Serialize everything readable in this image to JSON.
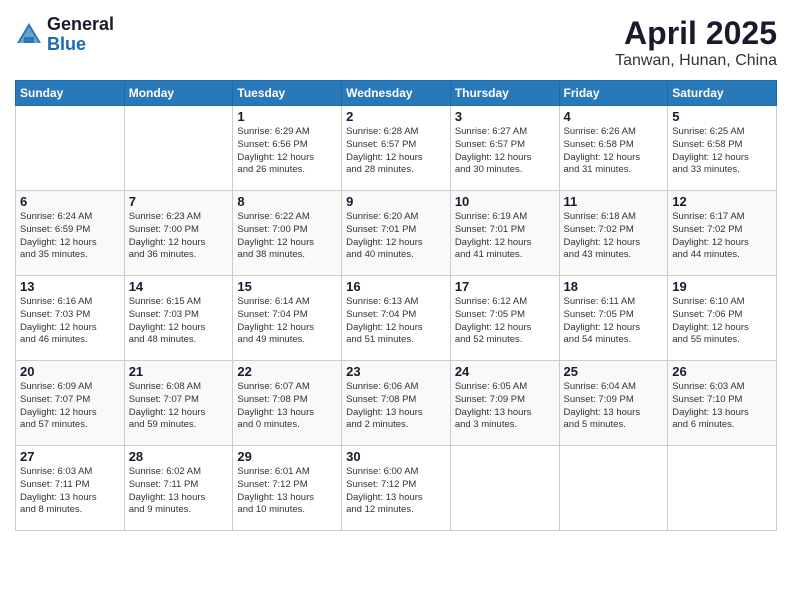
{
  "logo": {
    "general": "General",
    "blue": "Blue"
  },
  "title": "April 2025",
  "subtitle": "Tanwan, Hunan, China",
  "days_of_week": [
    "Sunday",
    "Monday",
    "Tuesday",
    "Wednesday",
    "Thursday",
    "Friday",
    "Saturday"
  ],
  "weeks": [
    [
      {
        "day": null,
        "info": null
      },
      {
        "day": null,
        "info": null
      },
      {
        "day": "1",
        "info": "Sunrise: 6:29 AM\nSunset: 6:56 PM\nDaylight: 12 hours\nand 26 minutes."
      },
      {
        "day": "2",
        "info": "Sunrise: 6:28 AM\nSunset: 6:57 PM\nDaylight: 12 hours\nand 28 minutes."
      },
      {
        "day": "3",
        "info": "Sunrise: 6:27 AM\nSunset: 6:57 PM\nDaylight: 12 hours\nand 30 minutes."
      },
      {
        "day": "4",
        "info": "Sunrise: 6:26 AM\nSunset: 6:58 PM\nDaylight: 12 hours\nand 31 minutes."
      },
      {
        "day": "5",
        "info": "Sunrise: 6:25 AM\nSunset: 6:58 PM\nDaylight: 12 hours\nand 33 minutes."
      }
    ],
    [
      {
        "day": "6",
        "info": "Sunrise: 6:24 AM\nSunset: 6:59 PM\nDaylight: 12 hours\nand 35 minutes."
      },
      {
        "day": "7",
        "info": "Sunrise: 6:23 AM\nSunset: 7:00 PM\nDaylight: 12 hours\nand 36 minutes."
      },
      {
        "day": "8",
        "info": "Sunrise: 6:22 AM\nSunset: 7:00 PM\nDaylight: 12 hours\nand 38 minutes."
      },
      {
        "day": "9",
        "info": "Sunrise: 6:20 AM\nSunset: 7:01 PM\nDaylight: 12 hours\nand 40 minutes."
      },
      {
        "day": "10",
        "info": "Sunrise: 6:19 AM\nSunset: 7:01 PM\nDaylight: 12 hours\nand 41 minutes."
      },
      {
        "day": "11",
        "info": "Sunrise: 6:18 AM\nSunset: 7:02 PM\nDaylight: 12 hours\nand 43 minutes."
      },
      {
        "day": "12",
        "info": "Sunrise: 6:17 AM\nSunset: 7:02 PM\nDaylight: 12 hours\nand 44 minutes."
      }
    ],
    [
      {
        "day": "13",
        "info": "Sunrise: 6:16 AM\nSunset: 7:03 PM\nDaylight: 12 hours\nand 46 minutes."
      },
      {
        "day": "14",
        "info": "Sunrise: 6:15 AM\nSunset: 7:03 PM\nDaylight: 12 hours\nand 48 minutes."
      },
      {
        "day": "15",
        "info": "Sunrise: 6:14 AM\nSunset: 7:04 PM\nDaylight: 12 hours\nand 49 minutes."
      },
      {
        "day": "16",
        "info": "Sunrise: 6:13 AM\nSunset: 7:04 PM\nDaylight: 12 hours\nand 51 minutes."
      },
      {
        "day": "17",
        "info": "Sunrise: 6:12 AM\nSunset: 7:05 PM\nDaylight: 12 hours\nand 52 minutes."
      },
      {
        "day": "18",
        "info": "Sunrise: 6:11 AM\nSunset: 7:05 PM\nDaylight: 12 hours\nand 54 minutes."
      },
      {
        "day": "19",
        "info": "Sunrise: 6:10 AM\nSunset: 7:06 PM\nDaylight: 12 hours\nand 55 minutes."
      }
    ],
    [
      {
        "day": "20",
        "info": "Sunrise: 6:09 AM\nSunset: 7:07 PM\nDaylight: 12 hours\nand 57 minutes."
      },
      {
        "day": "21",
        "info": "Sunrise: 6:08 AM\nSunset: 7:07 PM\nDaylight: 12 hours\nand 59 minutes."
      },
      {
        "day": "22",
        "info": "Sunrise: 6:07 AM\nSunset: 7:08 PM\nDaylight: 13 hours\nand 0 minutes."
      },
      {
        "day": "23",
        "info": "Sunrise: 6:06 AM\nSunset: 7:08 PM\nDaylight: 13 hours\nand 2 minutes."
      },
      {
        "day": "24",
        "info": "Sunrise: 6:05 AM\nSunset: 7:09 PM\nDaylight: 13 hours\nand 3 minutes."
      },
      {
        "day": "25",
        "info": "Sunrise: 6:04 AM\nSunset: 7:09 PM\nDaylight: 13 hours\nand 5 minutes."
      },
      {
        "day": "26",
        "info": "Sunrise: 6:03 AM\nSunset: 7:10 PM\nDaylight: 13 hours\nand 6 minutes."
      }
    ],
    [
      {
        "day": "27",
        "info": "Sunrise: 6:03 AM\nSunset: 7:11 PM\nDaylight: 13 hours\nand 8 minutes."
      },
      {
        "day": "28",
        "info": "Sunrise: 6:02 AM\nSunset: 7:11 PM\nDaylight: 13 hours\nand 9 minutes."
      },
      {
        "day": "29",
        "info": "Sunrise: 6:01 AM\nSunset: 7:12 PM\nDaylight: 13 hours\nand 10 minutes."
      },
      {
        "day": "30",
        "info": "Sunrise: 6:00 AM\nSunset: 7:12 PM\nDaylight: 13 hours\nand 12 minutes."
      },
      {
        "day": null,
        "info": null
      },
      {
        "day": null,
        "info": null
      },
      {
        "day": null,
        "info": null
      }
    ]
  ]
}
